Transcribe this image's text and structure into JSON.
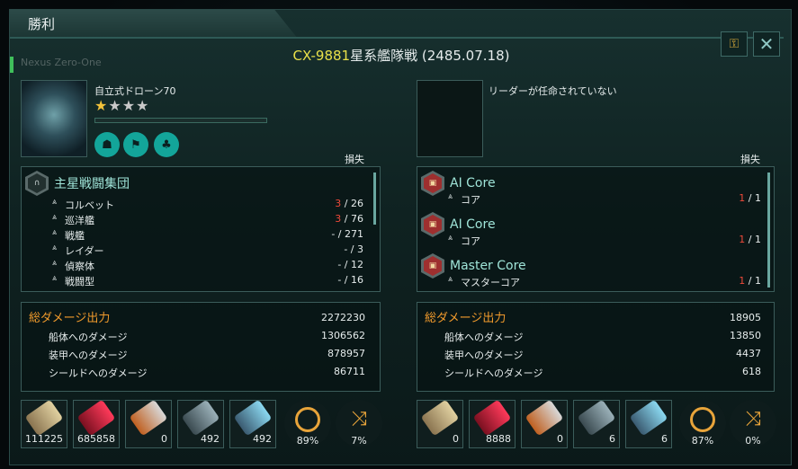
{
  "window": {
    "title": "勝利",
    "ghost_text": "Nexus Zero-One"
  },
  "header": {
    "system_id": "CX-9881",
    "battle_suffix": "星系艦隊戦 (2485.07.18)"
  },
  "buttons": {
    "close_glyph": "✕",
    "lock_glyph": "⚿"
  },
  "left": {
    "leader": {
      "name": "自立式ドローン70",
      "stars_filled": "★",
      "stars_empty": "★★★",
      "xp_fraction": 0
    },
    "loss_label": "損失",
    "group": {
      "name": "主星戦闘集団",
      "icon": "fleet-icon"
    },
    "rows": [
      {
        "label": "コルベット",
        "lost": "3",
        "total": " / 26",
        "lost_red": true
      },
      {
        "label": "巡洋艦",
        "lost": "3",
        "total": " / 76",
        "lost_red": true
      },
      {
        "label": "戦艦",
        "lost": "-",
        "total": " / 271",
        "lost_red": false
      },
      {
        "label": "レイダー",
        "lost": "-",
        "total": " / 3",
        "lost_red": false
      },
      {
        "label": "偵察体",
        "lost": "-",
        "total": " / 12",
        "lost_red": false
      },
      {
        "label": "戦闘型",
        "lost": "-",
        "total": " / 16",
        "lost_red": false
      }
    ],
    "damage": {
      "title": "総ダメージ出力",
      "total": "2272230",
      "hull_label": "船体へのダメージ",
      "hull": "1306562",
      "armor_label": "装甲へのダメージ",
      "armor": "878957",
      "shield_label": "シールドへのダメージ",
      "shield": "86711"
    },
    "weapons": [
      "111225",
      "685858",
      "0",
      "492",
      "492"
    ],
    "accuracy": "89%",
    "evasion": "7%"
  },
  "right": {
    "no_leader": "リーダーが任命されていない",
    "loss_label": "損失",
    "groups": [
      {
        "name": "AI Core",
        "row_label": "コア",
        "lost": "1",
        "total": " / 1"
      },
      {
        "name": "AI Core",
        "row_label": "コア",
        "lost": "1",
        "total": " / 1"
      },
      {
        "name": "Master Core",
        "row_label": "マスターコア",
        "lost": "1",
        "total": " / 1"
      }
    ],
    "damage": {
      "title": "総ダメージ出力",
      "total": "18905",
      "hull_label": "船体へのダメージ",
      "hull": "13850",
      "armor_label": "装甲へのダメージ",
      "armor": "4437",
      "shield_label": "シールドへのダメージ",
      "shield": "618"
    },
    "weapons": [
      "0",
      "8888",
      "0",
      "6",
      "6"
    ],
    "accuracy": "87%",
    "evasion": "0%"
  },
  "colors": {
    "accent_yellow": "#e8e04a",
    "loss_red": "#ef4a3a",
    "damage_orange": "#f09a2c",
    "group_cyan": "#9fe4d8"
  }
}
